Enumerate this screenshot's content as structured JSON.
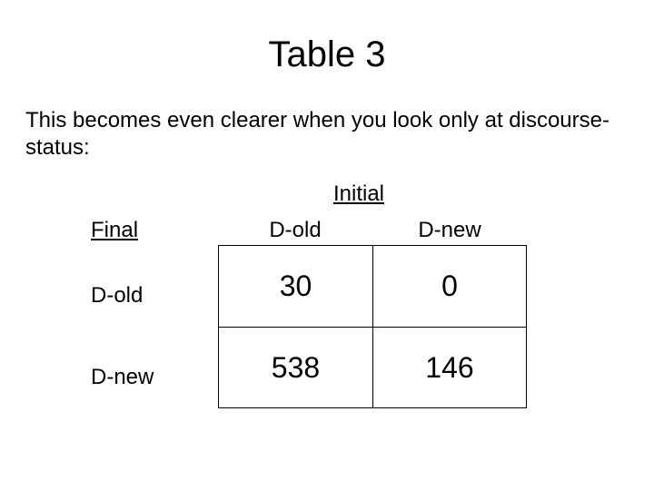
{
  "title": "Table 3",
  "subtitle": "This becomes even clearer when you look only at discourse-status:",
  "axis": {
    "columns_title": "Initial",
    "rows_title": "Final"
  },
  "columns": [
    "D-old",
    "D-new"
  ],
  "rows": [
    "D-old",
    "D-new"
  ],
  "chart_data": {
    "type": "table",
    "title": "Table 3",
    "row_labels": [
      "D-old",
      "D-new"
    ],
    "col_labels": [
      "D-old",
      "D-new"
    ],
    "values": [
      [
        30,
        0
      ],
      [
        538,
        146
      ]
    ]
  }
}
